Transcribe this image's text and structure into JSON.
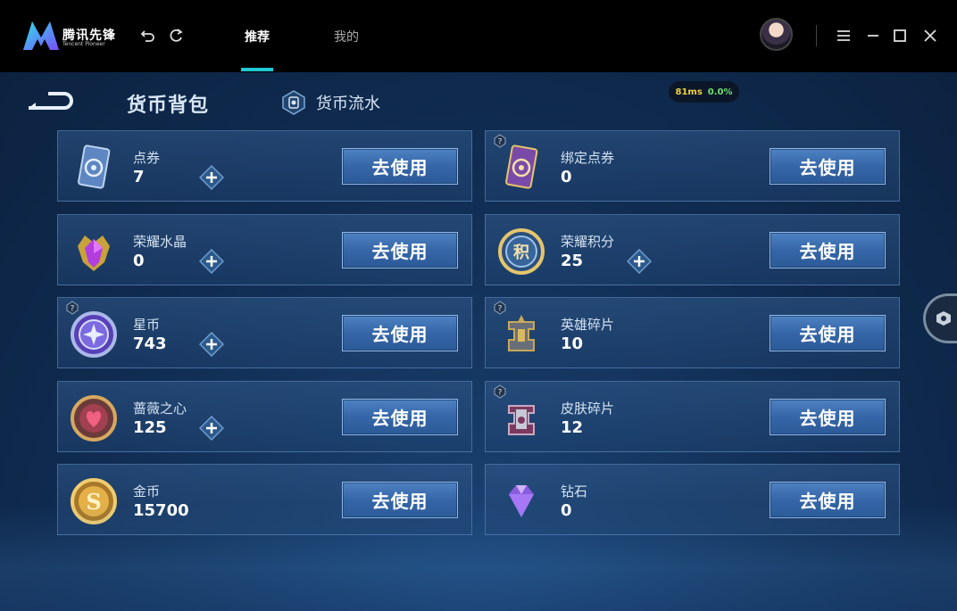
{
  "app": {
    "logo_text": "腾讯先锋",
    "logo_subtext": "Tencent Pioneer"
  },
  "nav": {
    "tabs": [
      {
        "label": "推荐",
        "active": true
      },
      {
        "label": "我的",
        "active": false
      }
    ]
  },
  "page": {
    "title": "货币背包",
    "flow_label": "货币流水",
    "ping_ms": "81ms",
    "ping_loss": "0.0%"
  },
  "colors": {
    "accent": "#1fc8d6",
    "button": "#3566a8",
    "ping_ms": "#f0d040",
    "ping_loss": "#6fe06f"
  },
  "currencies": [
    {
      "name": "点券",
      "value": "7",
      "icon": "coupon-card-icon",
      "has_plus": true,
      "has_help": false,
      "button": "去使用"
    },
    {
      "name": "绑定点券",
      "value": "0",
      "icon": "bound-coupon-card-icon",
      "has_plus": false,
      "has_help": true,
      "button": "去使用"
    },
    {
      "name": "荣耀水晶",
      "value": "0",
      "icon": "glory-crystal-icon",
      "has_plus": true,
      "has_help": false,
      "button": "去使用"
    },
    {
      "name": "荣耀积分",
      "value": "25",
      "icon": "glory-points-icon",
      "has_plus": true,
      "has_help": false,
      "button": "去使用"
    },
    {
      "name": "星币",
      "value": "743",
      "icon": "star-coin-icon",
      "has_plus": true,
      "has_help": true,
      "button": "去使用"
    },
    {
      "name": "英雄碎片",
      "value": "10",
      "icon": "hero-fragment-icon",
      "has_plus": false,
      "has_help": true,
      "button": "去使用"
    },
    {
      "name": "蔷薇之心",
      "value": "125",
      "icon": "rose-heart-icon",
      "has_plus": true,
      "has_help": false,
      "button": "去使用"
    },
    {
      "name": "皮肤碎片",
      "value": "12",
      "icon": "skin-fragment-icon",
      "has_plus": false,
      "has_help": true,
      "button": "去使用"
    },
    {
      "name": "金币",
      "value": "15700",
      "icon": "gold-coin-icon",
      "has_plus": false,
      "has_help": false,
      "button": "去使用"
    },
    {
      "name": "钻石",
      "value": "0",
      "icon": "diamond-icon",
      "has_plus": false,
      "has_help": false,
      "button": "去使用"
    }
  ]
}
